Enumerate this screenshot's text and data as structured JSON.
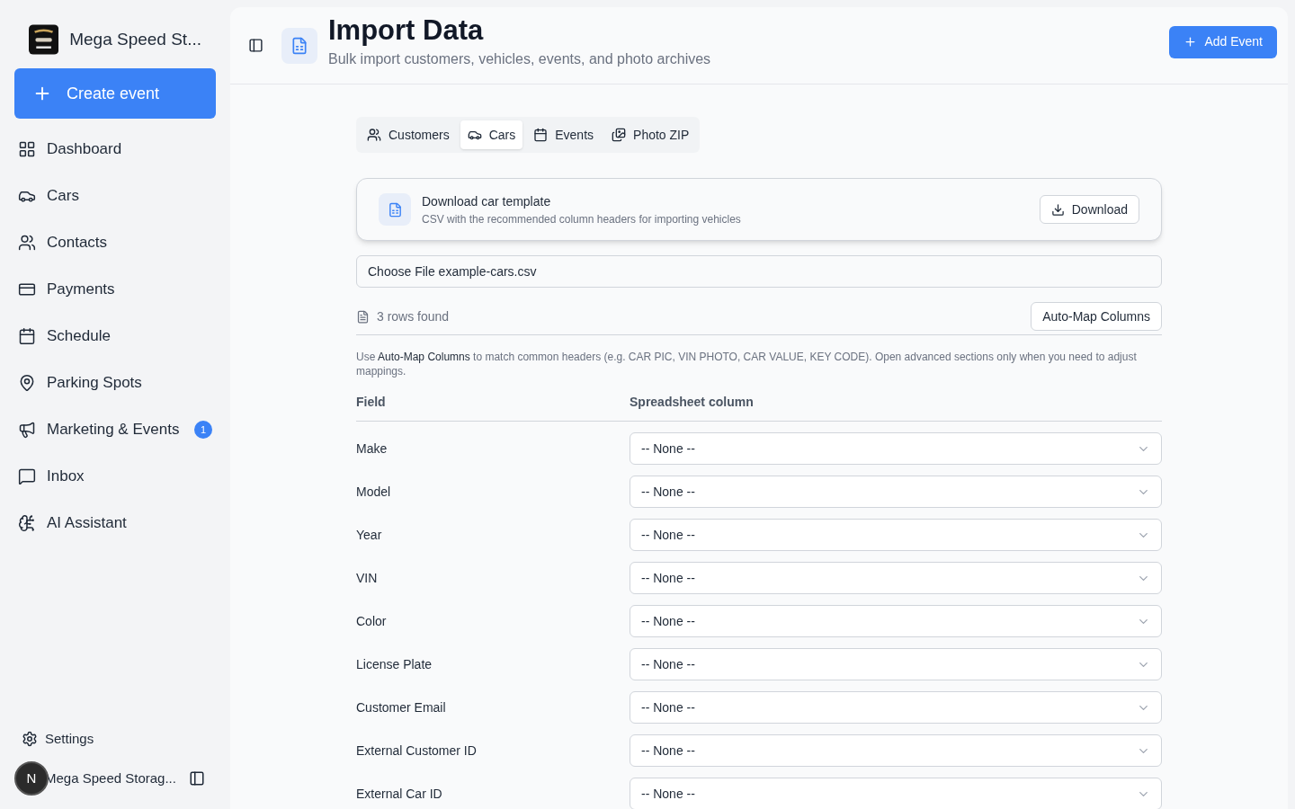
{
  "sidebar": {
    "brand": "Mega Speed St...",
    "create_button": "Create event",
    "items": [
      {
        "kind": "dashboard",
        "label": "Dashboard"
      },
      {
        "kind": "cars",
        "label": "Cars"
      },
      {
        "kind": "contacts",
        "label": "Contacts"
      },
      {
        "kind": "payments",
        "label": "Payments"
      },
      {
        "kind": "schedule",
        "label": "Schedule"
      },
      {
        "kind": "parking",
        "label": "Parking Spots"
      },
      {
        "kind": "marketing",
        "label": "Marketing & Events",
        "badge": "1"
      },
      {
        "kind": "inbox",
        "label": "Inbox"
      },
      {
        "kind": "ai",
        "label": "AI Assistant"
      }
    ],
    "settings": "Settings",
    "account": {
      "initial": "N",
      "name": "Mega Speed Storag..."
    }
  },
  "header": {
    "title": "Import Data",
    "subtitle": "Bulk import customers, vehicles, events, and photo archives",
    "action": "Add Event"
  },
  "tabs": [
    {
      "kind": "customers",
      "label": "Customers",
      "selected": false
    },
    {
      "kind": "cars",
      "label": "Cars",
      "selected": true
    },
    {
      "kind": "events",
      "label": "Events",
      "selected": false
    },
    {
      "kind": "photos",
      "label": "Photo ZIP",
      "selected": false
    }
  ],
  "template": {
    "title": "Download car template",
    "description": "CSV with the recommended column headers for importing vehicles",
    "button": "Download"
  },
  "file_field": {
    "value": "Choose File example-cars.csv"
  },
  "rows_found": "3 rows found",
  "automap_button": "Auto-Map Columns",
  "hint": "Use **Auto-Map Columns** to match common headers (e.g. CAR PIC, VIN PHOTO, CAR VALUE, KEY CODE). Open advanced sections only when you need to adjust mappings.",
  "mapping": {
    "columns": [
      "Field",
      "Spreadsheet column"
    ],
    "rows": [
      {
        "field": "Make",
        "value": "-- None --"
      },
      {
        "field": "Model",
        "value": "-- None --"
      },
      {
        "field": "Year",
        "value": "-- None --"
      },
      {
        "field": "VIN",
        "value": "-- None --"
      },
      {
        "field": "Color",
        "value": "-- None --"
      },
      {
        "field": "License Plate",
        "value": "-- None --"
      },
      {
        "field": "Customer Email",
        "value": "-- None --"
      },
      {
        "field": "External Customer ID",
        "value": "-- None --"
      },
      {
        "field": "External Car ID",
        "value": "-- None --"
      }
    ]
  }
}
